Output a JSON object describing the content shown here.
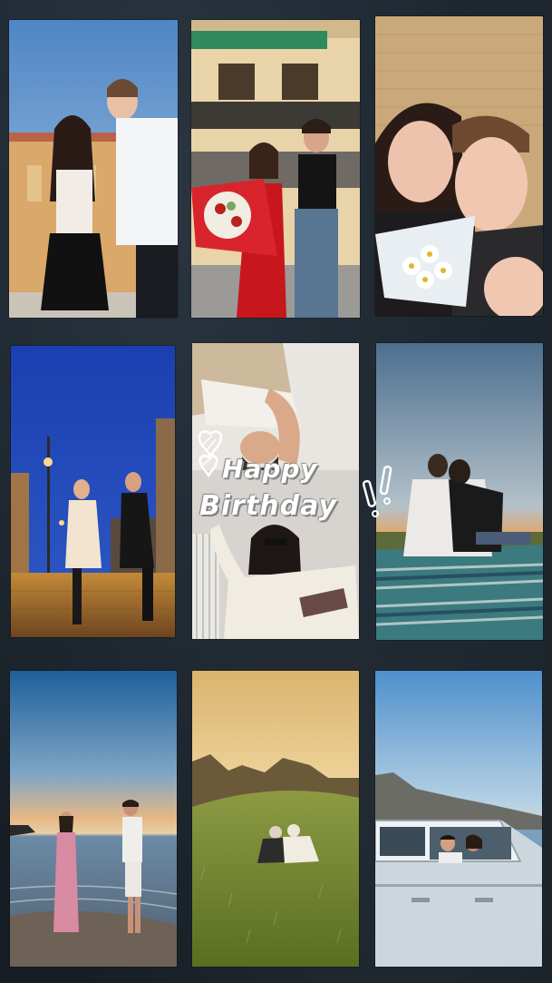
{
  "collage": {
    "greeting_line1": "Happy",
    "greeting_line2": "Birthday",
    "photos": [
      "couple-sunset-street",
      "couple-red-dress-flowers",
      "couple-selfie-daisies",
      "couple-night-street",
      "couple-selfie-birthday",
      "couple-blanket-sunset",
      "couple-beach-sunset",
      "couple-meadow-hills",
      "couple-vintage-car"
    ]
  },
  "colors": {
    "background": "#1b232b",
    "accent_red": "#c8161d",
    "sky_blue": "#3a74b6",
    "night_blue": "#1b3fb0"
  }
}
